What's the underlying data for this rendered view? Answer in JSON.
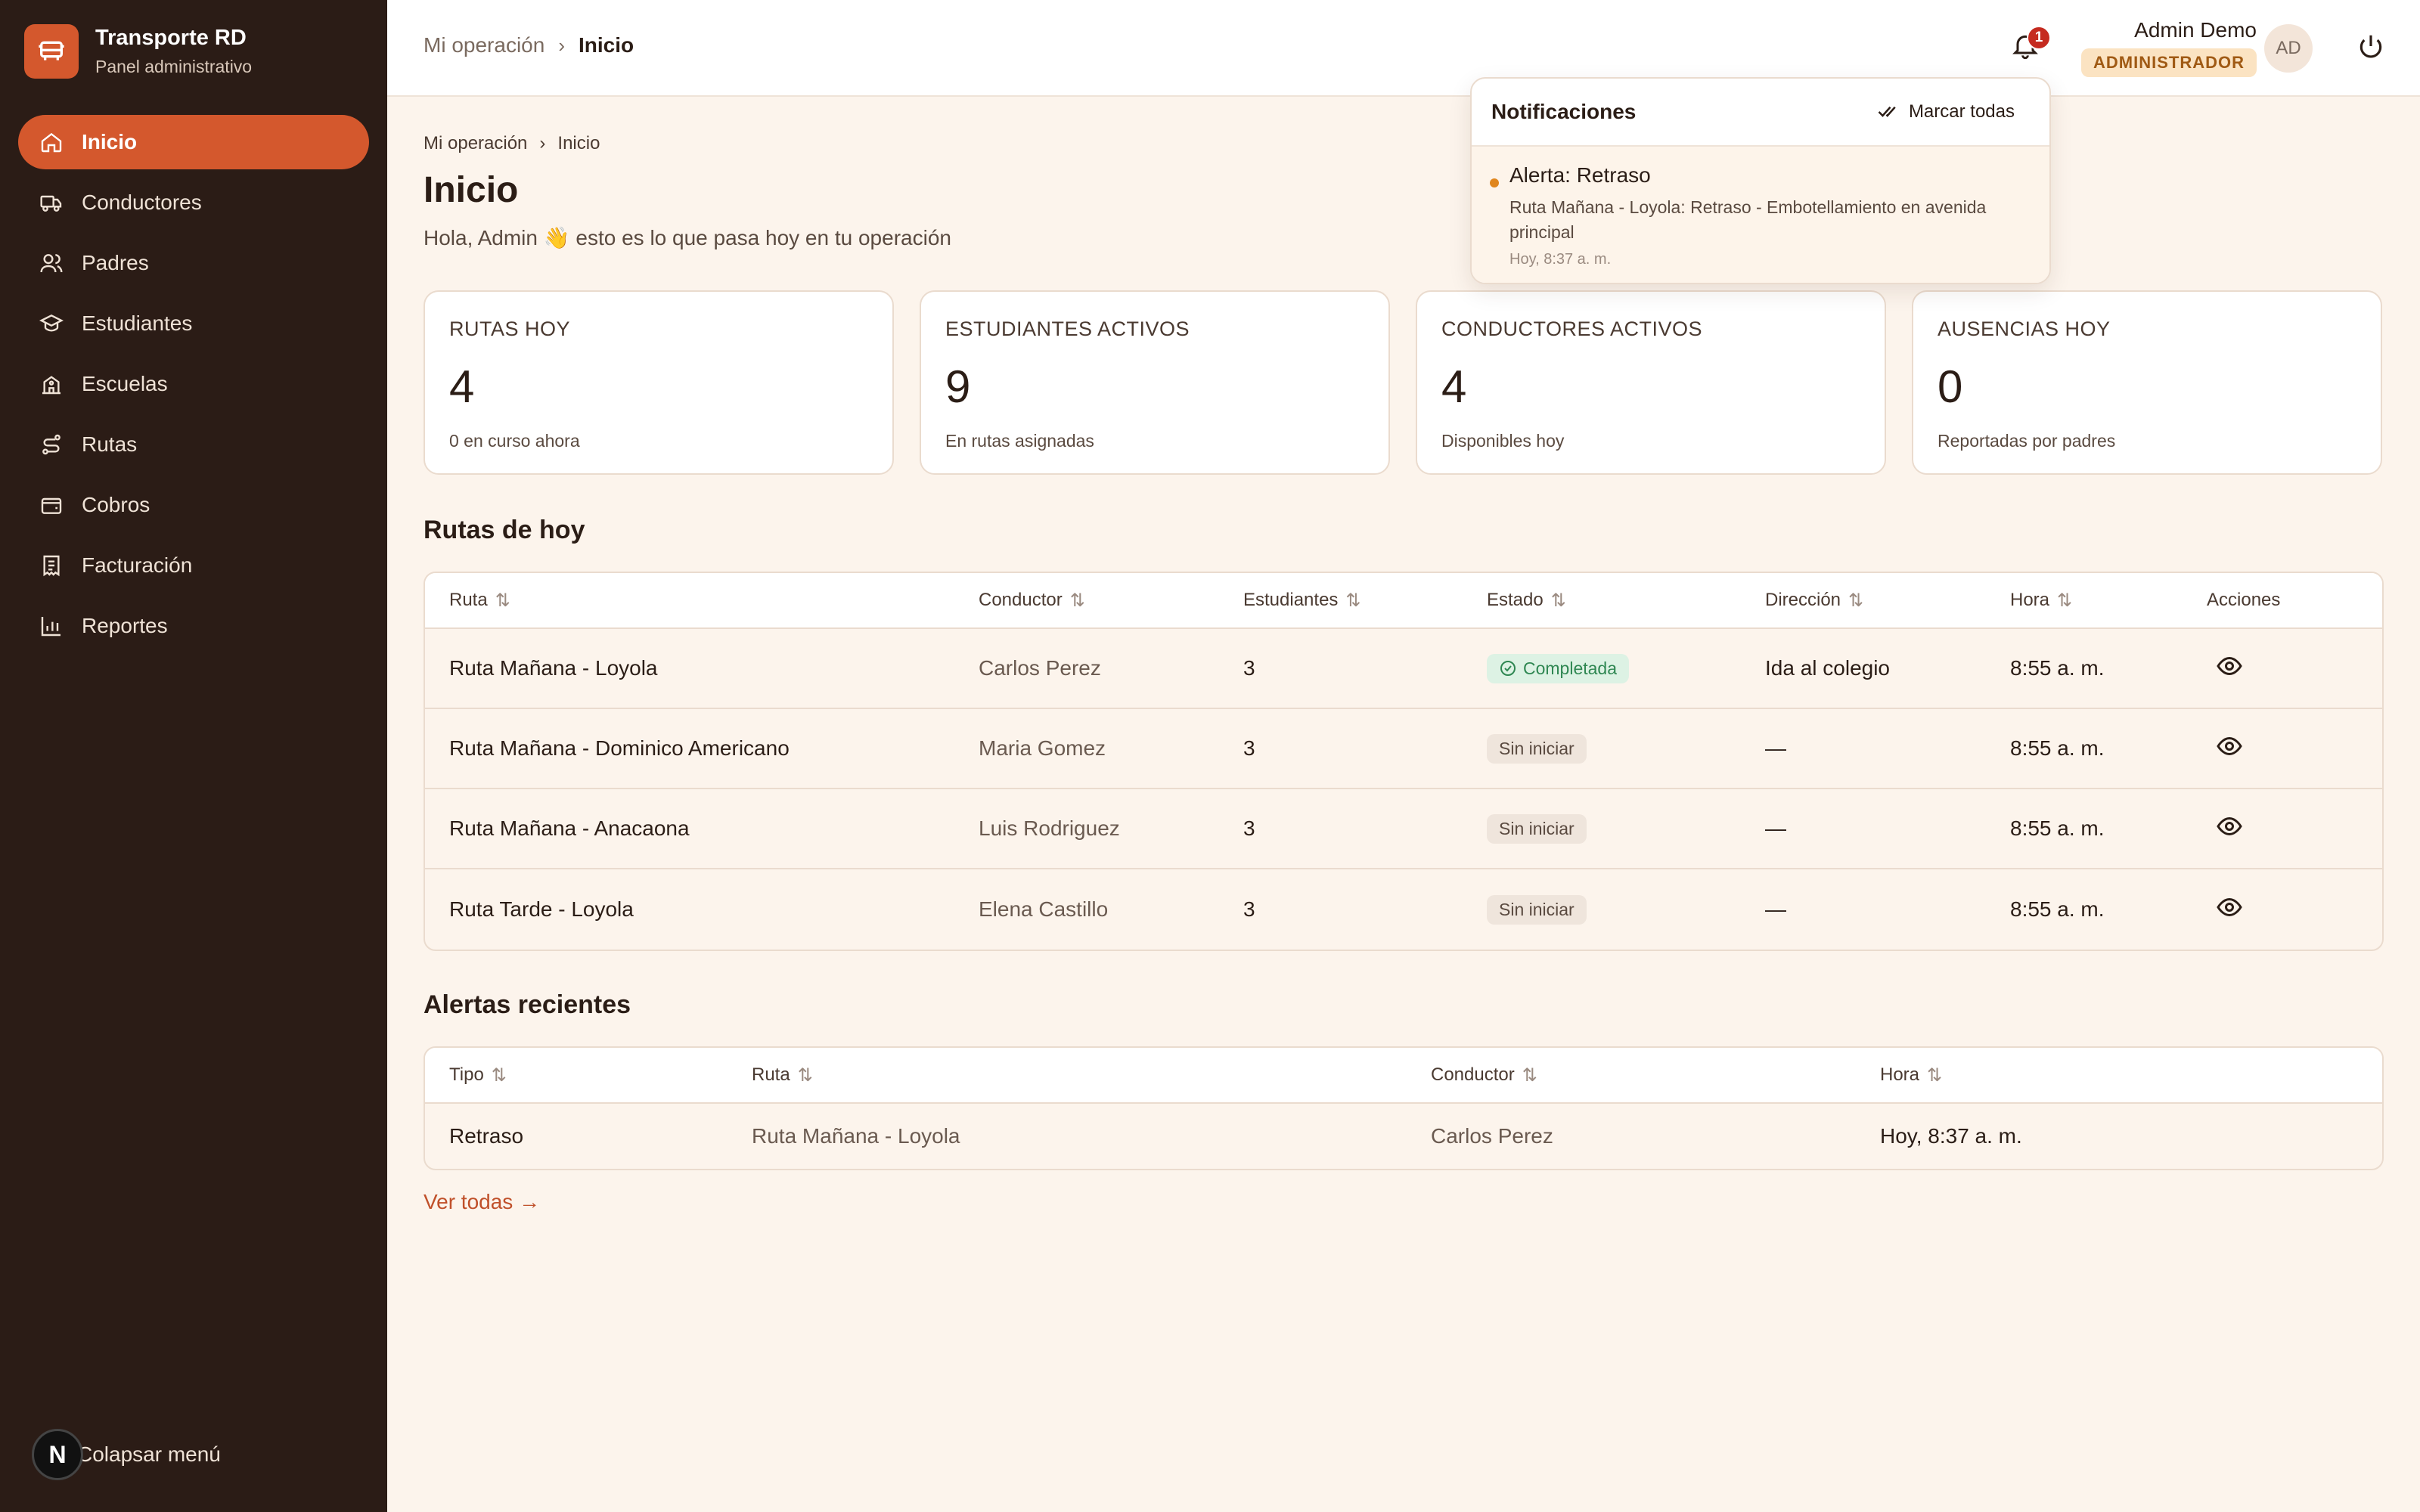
{
  "brand": {
    "title": "Transporte RD",
    "subtitle": "Panel administrativo",
    "logo_icon": "bus-icon",
    "accent": "#d4582d"
  },
  "sidebar": {
    "items": [
      {
        "label": "Inicio",
        "icon": "home-icon",
        "active": true
      },
      {
        "label": "Conductores",
        "icon": "truck-icon"
      },
      {
        "label": "Padres",
        "icon": "users-icon"
      },
      {
        "label": "Estudiantes",
        "icon": "graduation-cap-icon"
      },
      {
        "label": "Escuelas",
        "icon": "school-icon"
      },
      {
        "label": "Rutas",
        "icon": "route-icon"
      },
      {
        "label": "Cobros",
        "icon": "wallet-icon"
      },
      {
        "label": "Facturación",
        "icon": "receipt-icon"
      },
      {
        "label": "Reportes",
        "icon": "bar-chart-icon"
      }
    ],
    "collapse_label": "Colapsar menú",
    "dev_badge": "N"
  },
  "topbar": {
    "breadcrumb": [
      "Mi operación",
      "Inicio"
    ],
    "notif_count": "1",
    "user_name": "Admin Demo",
    "role": "ADMINISTRADOR",
    "avatar_initials": "AD"
  },
  "page": {
    "breadcrumb": [
      "Mi operación",
      "Inicio"
    ],
    "title": "Inicio",
    "subtitle": "Hola, Admin 👋 esto es lo que pasa hoy en tu operación"
  },
  "stats": [
    {
      "label": "RUTAS HOY",
      "value": "4",
      "note": "0 en curso ahora"
    },
    {
      "label": "ESTUDIANTES ACTIVOS",
      "value": "9",
      "note": "En rutas asignadas"
    },
    {
      "label": "CONDUCTORES ACTIVOS",
      "value": "4",
      "note": "Disponibles hoy"
    },
    {
      "label": "AUSENCIAS HOY",
      "value": "0",
      "note": "Reportadas por padres"
    }
  ],
  "routes": {
    "title": "Rutas de hoy",
    "headers": [
      "Ruta",
      "Conductor",
      "Estudiantes",
      "Estado",
      "Dirección",
      "Hora",
      "Acciones"
    ],
    "rows": [
      {
        "ruta": "Ruta Mañana - Loyola",
        "conductor": "Carlos Perez",
        "estudiantes": "3",
        "estado": "Completada",
        "done": true,
        "direccion": "Ida al colegio",
        "hora": "8:55 a. m."
      },
      {
        "ruta": "Ruta Mañana - Dominico Americano",
        "conductor": "Maria Gomez",
        "estudiantes": "3",
        "estado": "Sin iniciar",
        "done": false,
        "direccion": "—",
        "hora": "8:55 a. m."
      },
      {
        "ruta": "Ruta Mañana - Anacaona",
        "conductor": "Luis Rodriguez",
        "estudiantes": "3",
        "estado": "Sin iniciar",
        "done": false,
        "direccion": "—",
        "hora": "8:55 a. m."
      },
      {
        "ruta": "Ruta Tarde - Loyola",
        "conductor": "Elena Castillo",
        "estudiantes": "3",
        "estado": "Sin iniciar",
        "done": false,
        "direccion": "—",
        "hora": "8:55 a. m."
      }
    ]
  },
  "alerts": {
    "title": "Alertas recientes",
    "headers": [
      "Tipo",
      "Ruta",
      "Conductor",
      "Hora"
    ],
    "rows": [
      {
        "tipo": "Retraso",
        "ruta": "Ruta Mañana - Loyola",
        "conductor": "Carlos Perez",
        "hora": "Hoy, 8:37 a. m."
      }
    ],
    "see_all": "Ver todas →"
  },
  "notifications": {
    "title": "Notificaciones",
    "mark_all": "Marcar todas",
    "items": [
      {
        "title": "Alerta: Retraso",
        "body": "Ruta Mañana - Loyola: Retraso - Embotellamiento en avenida principal",
        "time": "Hoy, 8:37 a. m."
      }
    ]
  }
}
